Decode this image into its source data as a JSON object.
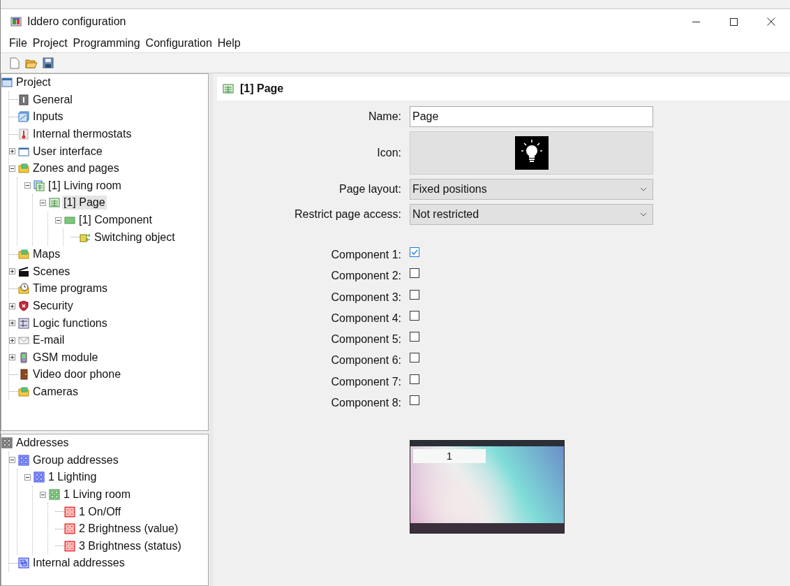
{
  "window": {
    "title": "Iddero configuration"
  },
  "menu": [
    "File",
    "Project",
    "Programming",
    "Configuration",
    "Help"
  ],
  "toolbar": [
    {
      "kind": "new"
    },
    {
      "kind": "open"
    },
    {
      "kind": "save"
    }
  ],
  "project_tree": {
    "label": "Project",
    "kind": "project",
    "children": [
      {
        "label": "General",
        "kind": "info",
        "selected": false
      },
      {
        "label": "Inputs",
        "kind": "inputs",
        "selected": false
      },
      {
        "label": "Internal thermostats",
        "kind": "thermo",
        "selected": false
      },
      {
        "label": "User interface",
        "kind": "window",
        "expanded": false,
        "selected": false
      },
      {
        "label": "Zones and pages",
        "kind": "folder",
        "expanded": true,
        "selected": false,
        "children": [
          {
            "label": "[1] Living room",
            "kind": "pages",
            "expanded": true,
            "selected": false,
            "children": [
              {
                "label": "[1] Page",
                "kind": "page",
                "expanded": true,
                "selected": true,
                "children": [
                  {
                    "label": "[1] Component",
                    "kind": "component",
                    "expanded": true,
                    "selected": false,
                    "children": [
                      {
                        "label": "Switching object",
                        "kind": "switch",
                        "selected": false
                      }
                    ]
                  }
                ]
              }
            ]
          }
        ]
      },
      {
        "label": "Maps",
        "kind": "folder",
        "selected": false
      },
      {
        "label": "Scenes",
        "kind": "clapper",
        "expanded": false,
        "selected": false
      },
      {
        "label": "Time programs",
        "kind": "clock",
        "selected": false
      },
      {
        "label": "Security",
        "kind": "shield",
        "expanded": false,
        "selected": false
      },
      {
        "label": "Logic functions",
        "kind": "logic",
        "expanded": false,
        "selected": false
      },
      {
        "label": "E-mail",
        "kind": "mail",
        "expanded": false,
        "selected": false
      },
      {
        "label": "GSM module",
        "kind": "phone",
        "expanded": false,
        "selected": false
      },
      {
        "label": "Video door phone",
        "kind": "door",
        "selected": false
      },
      {
        "label": "Cameras",
        "kind": "folder",
        "selected": false
      }
    ]
  },
  "address_tree": {
    "label": "Addresses",
    "kind": "grid-black",
    "children": [
      {
        "label": "Group addresses",
        "kind": "grid-blue",
        "expanded": true,
        "selected": false,
        "children": [
          {
            "label": "1 Lighting",
            "kind": "grid-blue",
            "expanded": true,
            "selected": false,
            "children": [
              {
                "label": "1 Living room",
                "kind": "grid-green",
                "expanded": true,
                "selected": false,
                "children": [
                  {
                    "label": "1 On/Off",
                    "kind": "grid-red",
                    "selected": false
                  },
                  {
                    "label": "2 Brightness (value)",
                    "kind": "grid-red",
                    "selected": false
                  },
                  {
                    "label": "3 Brightness (status)",
                    "kind": "grid-red",
                    "selected": false
                  }
                ]
              }
            ]
          }
        ]
      },
      {
        "label": "Internal addresses",
        "kind": "internal",
        "selected": false
      }
    ]
  },
  "panel": {
    "title": "[1] Page",
    "fields": [
      {
        "kind": "text",
        "label": "Name:",
        "value": "Page"
      },
      {
        "kind": "icon",
        "label": "Icon:"
      },
      {
        "kind": "select",
        "label": "Page layout:",
        "value": "Fixed positions"
      },
      {
        "kind": "select",
        "label": "Restrict page access:",
        "value": "Not restricted"
      }
    ],
    "components": [
      {
        "label": "Component 1:",
        "checked": true
      },
      {
        "label": "Component 2:",
        "checked": false
      },
      {
        "label": "Component 3:",
        "checked": false
      },
      {
        "label": "Component 4:",
        "checked": false
      },
      {
        "label": "Component 5:",
        "checked": false
      },
      {
        "label": "Component 6:",
        "checked": false
      },
      {
        "label": "Component 7:",
        "checked": false
      },
      {
        "label": "Component 8:",
        "checked": false
      }
    ],
    "preview": {
      "component_label": "1"
    }
  }
}
